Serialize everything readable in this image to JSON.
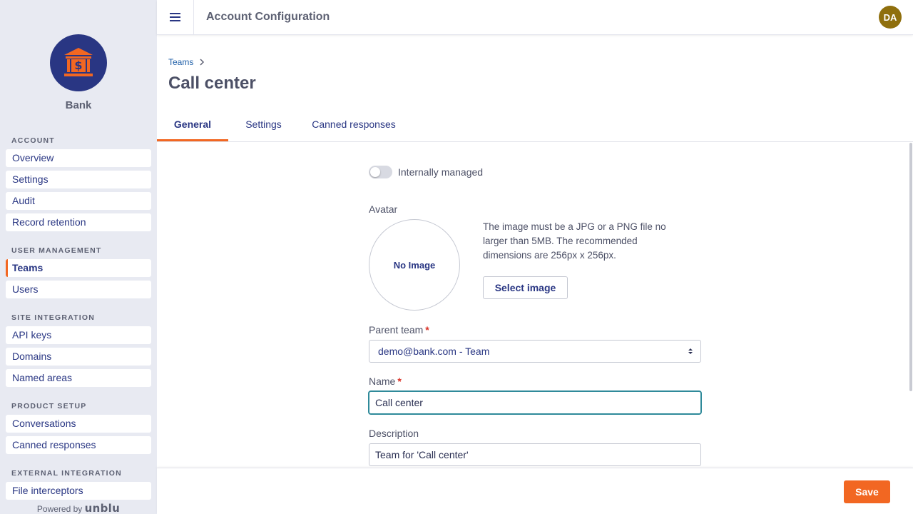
{
  "brand": {
    "name": "Bank",
    "icon": "bank-icon"
  },
  "sidebar": {
    "sections": [
      {
        "title": "ACCOUNT",
        "items": [
          "Overview",
          "Settings",
          "Audit",
          "Record retention"
        ]
      },
      {
        "title": "USER MANAGEMENT",
        "items": [
          "Teams",
          "Users"
        ]
      },
      {
        "title": "SITE INTEGRATION",
        "items": [
          "API keys",
          "Domains",
          "Named areas"
        ]
      },
      {
        "title": "PRODUCT SETUP",
        "items": [
          "Conversations",
          "Canned responses"
        ]
      },
      {
        "title": "EXTERNAL INTEGRATION",
        "items": [
          "File interceptors"
        ]
      }
    ],
    "active_item": "Teams",
    "powered_by": "Powered by",
    "powered_logo": "unblu"
  },
  "header": {
    "title": "Account Configuration",
    "avatar_initials": "DA",
    "menu_icon": "hamburger-icon"
  },
  "breadcrumb": {
    "items": [
      "Teams"
    ]
  },
  "page": {
    "title": "Call center"
  },
  "tabs": [
    {
      "label": "General",
      "active": true
    },
    {
      "label": "Settings",
      "active": false
    },
    {
      "label": "Canned responses",
      "active": false
    }
  ],
  "form": {
    "internally_managed_label": "Internally managed",
    "internally_managed": false,
    "avatar_label": "Avatar",
    "avatar_placeholder": "No Image",
    "avatar_hint": "The image must be a JPG or a PNG file no larger than 5MB. The recommended dimensions are 256px x 256px.",
    "select_image_label": "Select image",
    "parent_team_label": "Parent team",
    "parent_team_value": "demo@bank.com - Team",
    "name_label": "Name",
    "name_value": "Call center",
    "description_label": "Description",
    "description_value": "Team for 'Call center'",
    "required_mark": "*"
  },
  "footer": {
    "save_label": "Save"
  },
  "colors": {
    "accent": "#f26722",
    "brand": "#293683",
    "avatar": "#8f6f0d",
    "focus": "#2f8a9a"
  }
}
